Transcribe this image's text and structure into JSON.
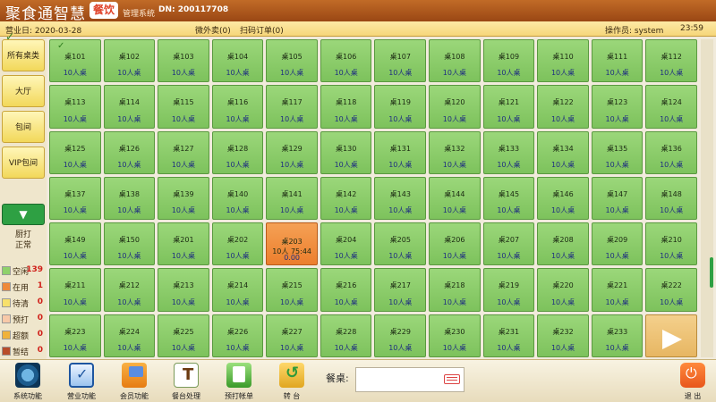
{
  "header": {
    "logo_text": "聚食通智慧",
    "logo_badge": "餐饮",
    "system_name": "管理系统",
    "dn": "DN: 200117708"
  },
  "infobar": {
    "business_date": "营业日: 2020-03-28",
    "takeout": "微外卖(0)",
    "scan_orders": "扫码订单(0)",
    "operator": "操作员: system",
    "time": "23:59"
  },
  "sidebar": {
    "categories": [
      {
        "label": "所有桌类",
        "selected": true
      },
      {
        "label": "大厅",
        "selected": false
      },
      {
        "label": "包间",
        "selected": false
      },
      {
        "label": "VIP包间",
        "selected": false
      }
    ],
    "scroll_down": "▼",
    "kitchen_line1": "厨打",
    "kitchen_line2": "正常",
    "legend": [
      {
        "label": "空闲",
        "count": "139",
        "color": "#8fd16a"
      },
      {
        "label": "在用",
        "count": "1",
        "color": "#ef8a3a"
      },
      {
        "label": "待清",
        "count": "0",
        "color": "#f7e06b"
      },
      {
        "label": "预打",
        "count": "0",
        "color": "#f8c9a8"
      },
      {
        "label": "超额",
        "count": "0",
        "color": "#f0b23a"
      },
      {
        "label": "暂结",
        "count": "0",
        "color": "#b84d2a"
      }
    ]
  },
  "tables": [
    {
      "name": "桌101",
      "cap": "10人桌",
      "checked": true
    },
    {
      "name": "桌102",
      "cap": "10人桌"
    },
    {
      "name": "桌103",
      "cap": "10人桌"
    },
    {
      "name": "桌104",
      "cap": "10人桌"
    },
    {
      "name": "桌105",
      "cap": "10人桌"
    },
    {
      "name": "桌106",
      "cap": "10人桌"
    },
    {
      "name": "桌107",
      "cap": "10人桌"
    },
    {
      "name": "桌108",
      "cap": "10人桌"
    },
    {
      "name": "桌109",
      "cap": "10人桌"
    },
    {
      "name": "桌110",
      "cap": "10人桌"
    },
    {
      "name": "桌111",
      "cap": "10人桌"
    },
    {
      "name": "桌112",
      "cap": "10人桌"
    },
    {
      "name": "桌113",
      "cap": "10人桌"
    },
    {
      "name": "桌114",
      "cap": "10人桌"
    },
    {
      "name": "桌115",
      "cap": "10人桌"
    },
    {
      "name": "桌116",
      "cap": "10人桌"
    },
    {
      "name": "桌117",
      "cap": "10人桌"
    },
    {
      "name": "桌118",
      "cap": "10人桌"
    },
    {
      "name": "桌119",
      "cap": "10人桌"
    },
    {
      "name": "桌120",
      "cap": "10人桌"
    },
    {
      "name": "桌121",
      "cap": "10人桌"
    },
    {
      "name": "桌122",
      "cap": "10人桌"
    },
    {
      "name": "桌123",
      "cap": "10人桌"
    },
    {
      "name": "桌124",
      "cap": "10人桌"
    },
    {
      "name": "桌125",
      "cap": "10人桌"
    },
    {
      "name": "桌126",
      "cap": "10人桌"
    },
    {
      "name": "桌127",
      "cap": "10人桌"
    },
    {
      "name": "桌128",
      "cap": "10人桌"
    },
    {
      "name": "桌129",
      "cap": "10人桌"
    },
    {
      "name": "桌130",
      "cap": "10人桌"
    },
    {
      "name": "桌131",
      "cap": "10人桌"
    },
    {
      "name": "桌132",
      "cap": "10人桌"
    },
    {
      "name": "桌133",
      "cap": "10人桌"
    },
    {
      "name": "桌134",
      "cap": "10人桌"
    },
    {
      "name": "桌135",
      "cap": "10人桌"
    },
    {
      "name": "桌136",
      "cap": "10人桌"
    },
    {
      "name": "桌137",
      "cap": "10人桌"
    },
    {
      "name": "桌138",
      "cap": "10人桌"
    },
    {
      "name": "桌139",
      "cap": "10人桌"
    },
    {
      "name": "桌140",
      "cap": "10人桌"
    },
    {
      "name": "桌141",
      "cap": "10人桌"
    },
    {
      "name": "桌142",
      "cap": "10人桌"
    },
    {
      "name": "桌143",
      "cap": "10人桌"
    },
    {
      "name": "桌144",
      "cap": "10人桌"
    },
    {
      "name": "桌145",
      "cap": "10人桌"
    },
    {
      "name": "桌146",
      "cap": "10人桌"
    },
    {
      "name": "桌147",
      "cap": "10人桌"
    },
    {
      "name": "桌148",
      "cap": "10人桌"
    },
    {
      "name": "桌149",
      "cap": "10人桌"
    },
    {
      "name": "桌150",
      "cap": "10人桌"
    },
    {
      "name": "桌201",
      "cap": "10人桌"
    },
    {
      "name": "桌202",
      "cap": "10人桌"
    },
    {
      "name": "桌203",
      "occupied": true,
      "occ_line": "10人  75:44",
      "occ_amount": "0.00"
    },
    {
      "name": "桌204",
      "cap": "10人桌"
    },
    {
      "name": "桌205",
      "cap": "10人桌"
    },
    {
      "name": "桌206",
      "cap": "10人桌"
    },
    {
      "name": "桌207",
      "cap": "10人桌"
    },
    {
      "name": "桌208",
      "cap": "10人桌"
    },
    {
      "name": "桌209",
      "cap": "10人桌"
    },
    {
      "name": "桌210",
      "cap": "10人桌"
    },
    {
      "name": "桌211",
      "cap": "10人桌"
    },
    {
      "name": "桌212",
      "cap": "10人桌"
    },
    {
      "name": "桌213",
      "cap": "10人桌"
    },
    {
      "name": "桌214",
      "cap": "10人桌"
    },
    {
      "name": "桌215",
      "cap": "10人桌"
    },
    {
      "name": "桌216",
      "cap": "10人桌"
    },
    {
      "name": "桌217",
      "cap": "10人桌"
    },
    {
      "name": "桌218",
      "cap": "10人桌"
    },
    {
      "name": "桌219",
      "cap": "10人桌"
    },
    {
      "name": "桌220",
      "cap": "10人桌"
    },
    {
      "name": "桌221",
      "cap": "10人桌"
    },
    {
      "name": "桌222",
      "cap": "10人桌"
    },
    {
      "name": "桌223",
      "cap": "10人桌"
    },
    {
      "name": "桌224",
      "cap": "10人桌"
    },
    {
      "name": "桌225",
      "cap": "10人桌"
    },
    {
      "name": "桌226",
      "cap": "10人桌"
    },
    {
      "name": "桌227",
      "cap": "10人桌"
    },
    {
      "name": "桌228",
      "cap": "10人桌"
    },
    {
      "name": "桌229",
      "cap": "10人桌"
    },
    {
      "name": "桌230",
      "cap": "10人桌"
    },
    {
      "name": "桌231",
      "cap": "10人桌"
    },
    {
      "name": "桌232",
      "cap": "10人桌"
    },
    {
      "name": "桌233",
      "cap": "10人桌"
    }
  ],
  "toolbar": {
    "sys": "系统功能",
    "biz": "营业功能",
    "member": "会员功能",
    "tablemgr": "餐台处理",
    "prebill": "预打帐单",
    "transfer": "转 台",
    "table_label": "餐桌:",
    "table_value": "",
    "exit": "退 出"
  }
}
